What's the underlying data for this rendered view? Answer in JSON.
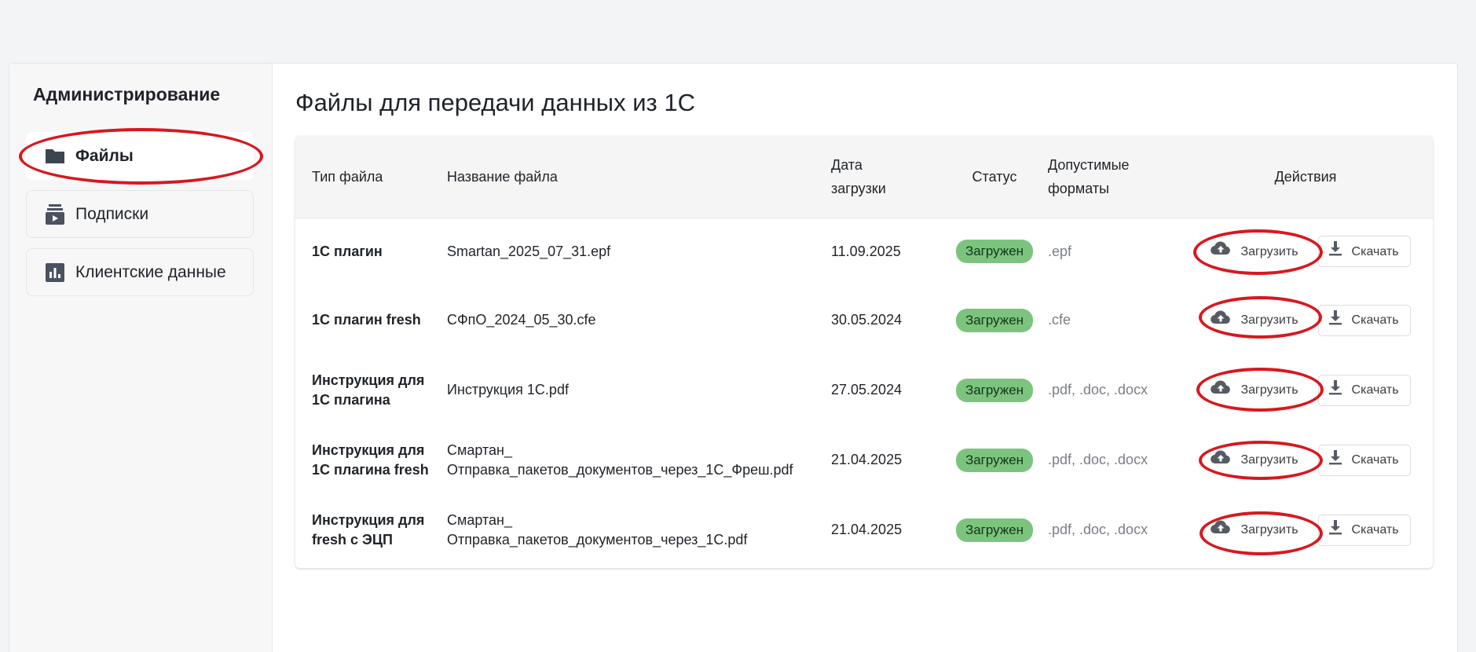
{
  "sidebar": {
    "title": "Администрирование",
    "items": [
      {
        "label": "Файлы",
        "icon": "folder-icon",
        "active": true
      },
      {
        "label": "Подписки",
        "icon": "subscriptions-icon",
        "active": false
      },
      {
        "label": "Клиентские данные",
        "icon": "bar-chart-icon",
        "active": false
      }
    ]
  },
  "main": {
    "title": "Файлы для передачи данных из 1С",
    "table": {
      "headers": {
        "type": "Тип файла",
        "name": "Название файла",
        "date_line1": "Дата",
        "date_line2": "загрузки",
        "status": "Статус",
        "formats_line1": "Допустимые",
        "formats_line2": "форматы",
        "actions": "Действия"
      },
      "rows": [
        {
          "type_l1": "1С плагин",
          "type_l2": "",
          "name_l1": "Smartan_2025_07_31.epf",
          "name_l2": "",
          "date": "11.09.2025",
          "status": "Загружен",
          "formats": ".epf"
        },
        {
          "type_l1": "1С плагин fresh",
          "type_l2": "",
          "name_l1": "СФпО_2024_05_30.cfe",
          "name_l2": "",
          "date": "30.05.2024",
          "status": "Загружен",
          "formats": ".cfe"
        },
        {
          "type_l1": "Инструкция для",
          "type_l2": "1С плагина",
          "name_l1": "Инструкция 1С.pdf",
          "name_l2": "",
          "date": "27.05.2024",
          "status": "Загружен",
          "formats": ".pdf, .doc, .docx"
        },
        {
          "type_l1": "Инструкция для",
          "type_l2": "1С плагина fresh",
          "name_l1": "Смартан_",
          "name_l2": "Отправка_пакетов_документов_через_1С_Фреш.pdf",
          "date": "21.04.2025",
          "status": "Загружен",
          "formats": ".pdf, .doc, .docx"
        },
        {
          "type_l1": "Инструкция для",
          "type_l2": "fresh с ЭЦП",
          "name_l1": "Смартан_",
          "name_l2": "Отправка_пакетов_документов_через_1С.pdf",
          "date": "21.04.2025",
          "status": "Загружен",
          "formats": ".pdf, .doc, .docx"
        }
      ],
      "upload_label": "Загрузить",
      "download_label": "Скачать"
    }
  },
  "colors": {
    "status_badge": "#7cc47e",
    "annotation_ring": "#d9171e"
  }
}
